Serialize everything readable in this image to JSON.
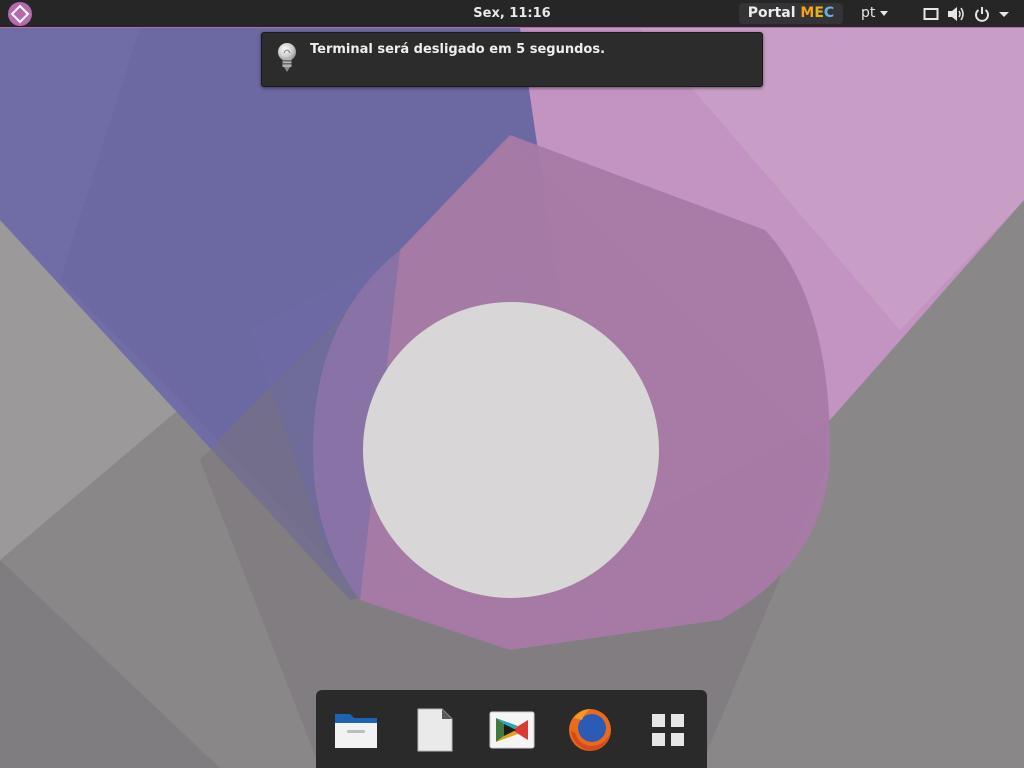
{
  "topbar": {
    "activities_icon": "activities-diamond-icon",
    "clock": "Sex, 11:16",
    "portal": {
      "prefix": "Portal ",
      "mec_m": "M",
      "mec_e": "E",
      "mec_c": "C"
    },
    "language": "pt",
    "system_icons": [
      "display-icon",
      "volume-icon",
      "power-icon",
      "chevron-down-icon"
    ]
  },
  "notification": {
    "icon": "lightbulb-icon",
    "text": "Terminal será desligado em 5 segundos."
  },
  "dock": {
    "items": [
      {
        "name": "files",
        "icon": "folder-icon"
      },
      {
        "name": "document",
        "icon": "document-icon"
      },
      {
        "name": "play-store",
        "icon": "play-store-icon"
      },
      {
        "name": "firefox",
        "icon": "firefox-icon"
      },
      {
        "name": "show-apps",
        "icon": "app-grid-icon"
      }
    ]
  },
  "colors": {
    "panel": "#262626",
    "accent": "#b36ab0",
    "wallpaper_gray": "#8a8789",
    "wallpaper_blue": "#6e6aa8",
    "wallpaper_pink": "#c896c6",
    "wallpaper_center": "#d9d6d8"
  }
}
